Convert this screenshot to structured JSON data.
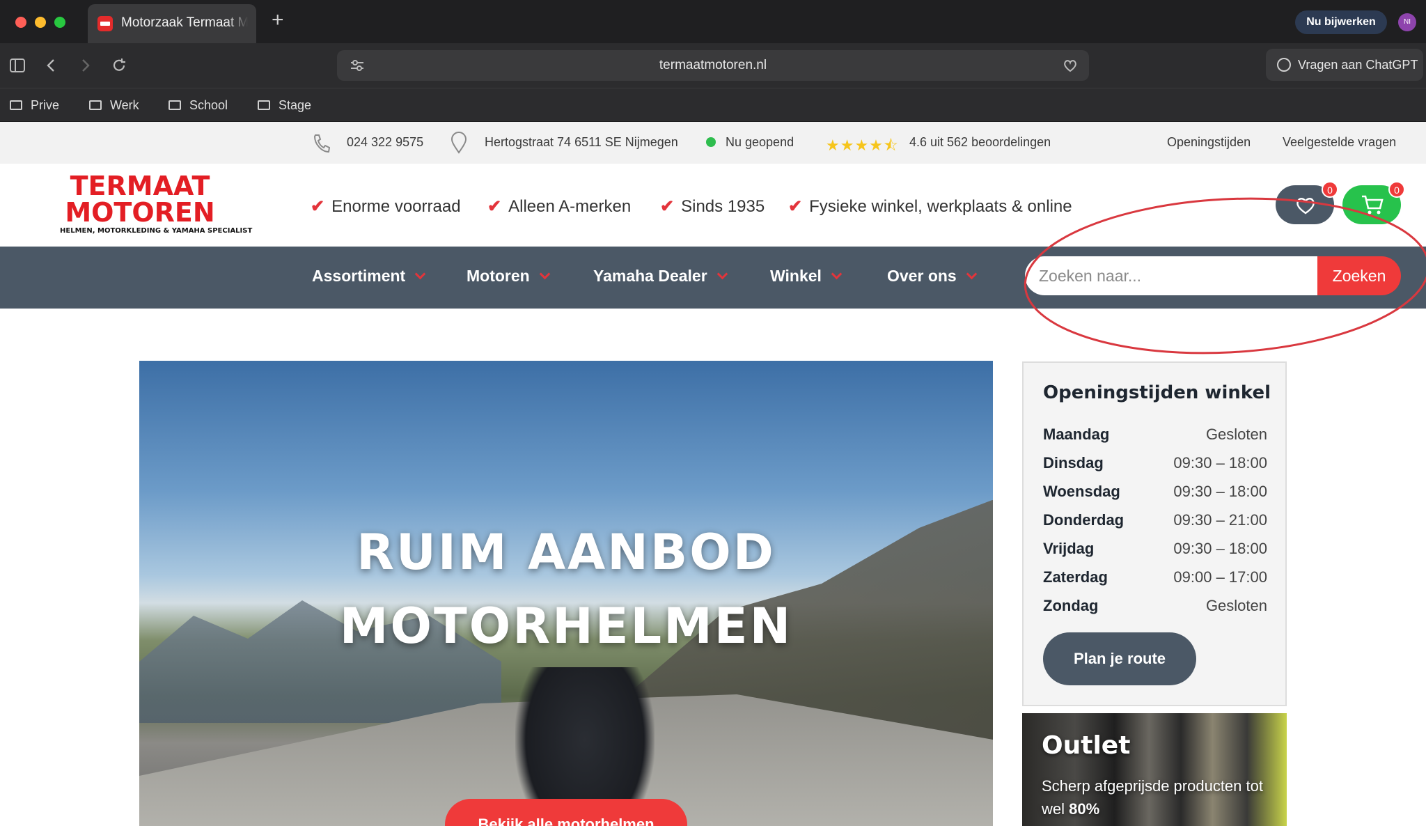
{
  "browser": {
    "tab_title": "Motorzaak Termaat Motoren",
    "url": "termaatmotoren.nl",
    "update_label": "Nu bijwerken",
    "profile_initials": "NI",
    "chatgpt_label": "Vragen aan ChatGPT",
    "bookmarks": [
      "Prive",
      "Werk",
      "School",
      "Stage"
    ]
  },
  "topinfo": {
    "phone": "024 322 9575",
    "address": "Hertogstraat 74 6511 SE Nijmegen",
    "open_status": "Nu geopend",
    "stars": "★★★★⯪",
    "rating": "4.6 uit 562 beoordelingen",
    "link_hours": "Openingstijden",
    "link_faq": "Veelgestelde vragen"
  },
  "logo": {
    "line1": "TERMAAT",
    "line2": "MOTOREN",
    "tagline": "HELMEN, MOTORKLEDING & YAMAHA SPECIALIST"
  },
  "usps": [
    "Enorme voorraad",
    "Alleen A-merken",
    "Sinds 1935",
    "Fysieke winkel, werkplaats & online"
  ],
  "header": {
    "wishlist_count": "0",
    "cart_count": "0"
  },
  "nav": [
    "Assortiment",
    "Motoren",
    "Yamaha Dealer",
    "Winkel",
    "Over ons"
  ],
  "search": {
    "placeholder": "Zoeken naar...",
    "button": "Zoeken"
  },
  "hero": {
    "title_line1": "RUIM AANBOD",
    "title_line2": "MOTORHELMEN",
    "button": "Bekijk alle motorhelmen"
  },
  "hours": {
    "title": "Openingstijden winkel",
    "rows": [
      {
        "day": "Maandag",
        "time": "Gesloten"
      },
      {
        "day": "Dinsdag",
        "time": "09:30 – 18:00"
      },
      {
        "day": "Woensdag",
        "time": "09:30 – 18:00"
      },
      {
        "day": "Donderdag",
        "time": "09:30 – 21:00"
      },
      {
        "day": "Vrijdag",
        "time": "09:30 – 18:00"
      },
      {
        "day": "Zaterdag",
        "time": "09:00 – 17:00"
      },
      {
        "day": "Zondag",
        "time": "Gesloten"
      }
    ],
    "route_button": "Plan je route"
  },
  "outlet": {
    "title": "Outlet",
    "subtitle": "Scherp afgeprijsde producten tot wel",
    "highlight": "80%"
  },
  "colors": {
    "brand_red": "#ef3a3a",
    "nav_slate": "#4b5866",
    "cart_green": "#27c24c",
    "star_yellow": "#f6c51b",
    "annotation_red": "#d9383f"
  }
}
